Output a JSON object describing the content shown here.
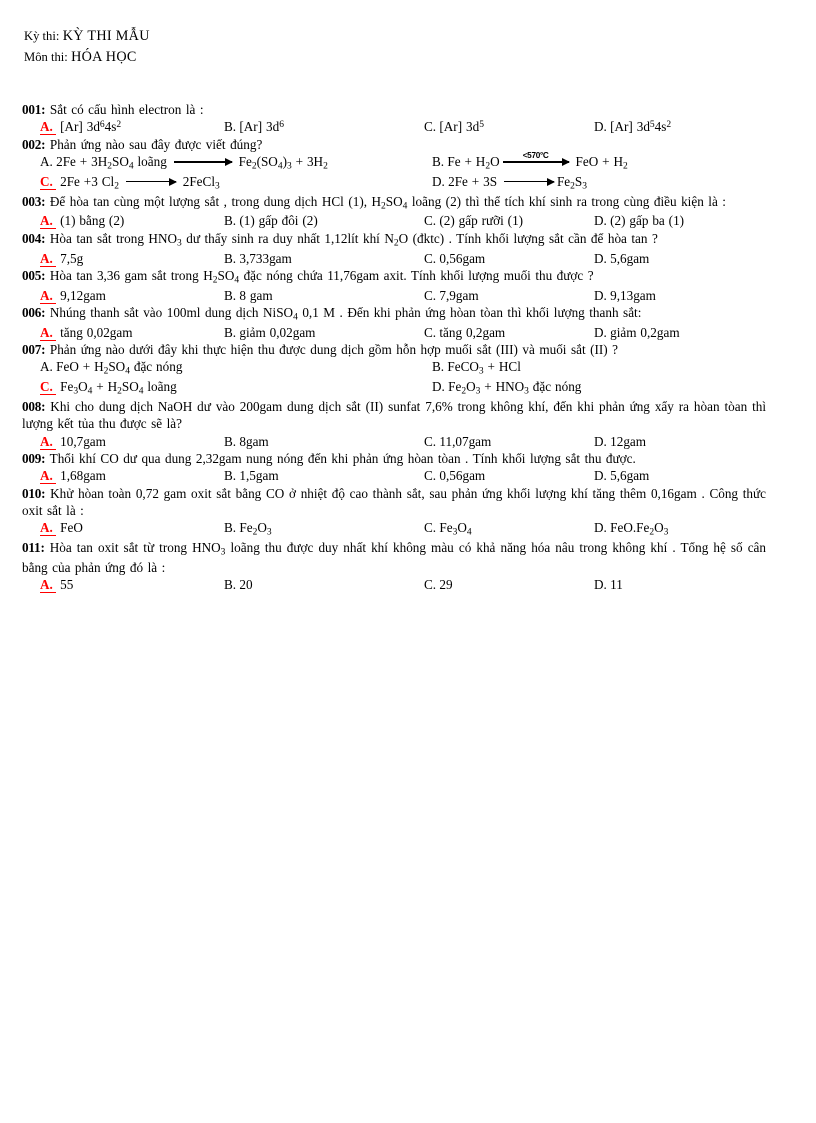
{
  "header": {
    "exam_label": "Kỳ thi:",
    "exam_value": "KỲ THI MẪU",
    "subject_label": "Môn thi:",
    "subject_value": "HÓA HỌC"
  },
  "colors": {
    "correct_answer": "#ff0000",
    "body_text": "#000000",
    "page_background": "#ffffff"
  },
  "questions": [
    {
      "number": "001:",
      "stem": "Sắt có cấu hình  electron  là :",
      "layout": "cols4",
      "options": [
        {
          "label": "A.",
          "correct": true,
          "text_html": "[Ar] 3d<sup>6</sup>4s<sup>2</sup>"
        },
        {
          "label": "B.",
          "correct": false,
          "text_html": "[Ar] 3d<sup>6</sup>"
        },
        {
          "label": "C.",
          "correct": false,
          "text_html": "[Ar] 3d<sup>5</sup>"
        },
        {
          "label": "D.",
          "correct": false,
          "text_html": "[Ar] 3d<sup>5</sup>4s<sup>2</sup>"
        }
      ]
    },
    {
      "number": "002:",
      "stem": "Phản ứng nào sau đây được viết  đúng?",
      "layout": "equations",
      "options": [
        {
          "label": "A.",
          "correct": false,
          "text_html": "2Fe + 3H<sub>2</sub>SO<sub>4</sub> loãng <ARROW-LONG> Fe<sub>2</sub>(SO<sub>4</sub>)<sub>3</sub> + 3H<sub>2</sub>"
        },
        {
          "label": "B.",
          "correct": false,
          "text_html": "Fe + H<sub>2</sub>O<ARROW-COND:&lt;570°C> FeO + H<sub>2</sub>"
        },
        {
          "label": "C.",
          "correct": true,
          "text_html": "2Fe +3 Cl<sub>2</sub> <ARROW-MED> 2FeCl<sub>3</sub>"
        },
        {
          "label": "D.",
          "correct": false,
          "text_html": "2Fe + 3S <ARROW-MED>Fe<sub>2</sub>S<sub>3</sub>"
        }
      ]
    },
    {
      "number": "003:",
      "stem": "Để hòa tan cùng một lượng sắt , trong dung dịch HCl (1), H<sub>2</sub>SO<sub>4</sub> loãng (2) thì thể tích khí sinh ra trong cùng điều kiện là :",
      "layout": "cols4",
      "options": [
        {
          "label": "A.",
          "correct": true,
          "text_html": "(1) bằng (2)"
        },
        {
          "label": "B.",
          "correct": false,
          "text_html": "(1) gấp đôi (2)"
        },
        {
          "label": "C.",
          "correct": false,
          "text_html": "(2) gấp rưỡi (1)"
        },
        {
          "label": "D.",
          "correct": false,
          "text_html": "(2) gấp ba (1)"
        }
      ]
    },
    {
      "number": "004:",
      "stem": "Hòa tan sắt trong HNO<sub>3</sub> dư thấy sinh ra duy nhất 1,12lít khí N<sub>2</sub>O (đktc) . Tính  khối lượng  sắt cần để hòa tan ?",
      "layout": "cols4",
      "options": [
        {
          "label": "A.",
          "correct": true,
          "text_html": "7,5g"
        },
        {
          "label": "B.",
          "correct": false,
          "text_html": "3,733gam"
        },
        {
          "label": "C.",
          "correct": false,
          "text_html": "0,56gam"
        },
        {
          "label": "D.",
          "correct": false,
          "text_html": "5,6gam"
        }
      ]
    },
    {
      "number": "005:",
      "stem": "Hòa tan 3,36 gam  sắt trong H<sub>2</sub>SO<sub>4</sub> đặc nóng chứa 11,76gam axit.  Tính  khối lượng muối thu được ?",
      "layout": "cols4",
      "options": [
        {
          "label": "A.",
          "correct": true,
          "text_html": "9,12gam"
        },
        {
          "label": "B.",
          "correct": false,
          "text_html": "8 gam"
        },
        {
          "label": "C.",
          "correct": false,
          "text_html": "7,9gam"
        },
        {
          "label": "D.",
          "correct": false,
          "text_html": "9,13gam"
        }
      ]
    },
    {
      "number": "006:",
      "stem": "Nhúng  thanh  sắt vào 100ml dung dịch NiSO<sub>4</sub> 0,1 M . Đến khi phản ứng hòan tòan thì khối lượng thanh sắt:",
      "layout": "cols4",
      "options": [
        {
          "label": "A.",
          "correct": true,
          "text_html": "tăng 0,02gam"
        },
        {
          "label": "B.",
          "correct": false,
          "text_html": "giảm 0,02gam"
        },
        {
          "label": "C.",
          "correct": false,
          "text_html": "tăng 0,2gam"
        },
        {
          "label": "D.",
          "correct": false,
          "text_html": "giảm 0,2gam"
        }
      ]
    },
    {
      "number": "007:",
      "stem": "Phản ứng nào dưới đây khi thực hiện thu được dung dịch gồm hỗn hợp muối sắt (III) và muối sắt (II) ?",
      "layout": "cols2",
      "options": [
        {
          "label": "A.",
          "correct": false,
          "text_html": "FeO + H<sub>2</sub>SO<sub>4</sub> đặc nóng"
        },
        {
          "label": "B.",
          "correct": false,
          "text_html": "FeCO<sub>3</sub> + HCl"
        },
        {
          "label": "C.",
          "correct": true,
          "text_html": "Fe<sub>3</sub>O<sub>4</sub> + H<sub>2</sub>SO<sub>4</sub> loãng"
        },
        {
          "label": "D.",
          "correct": false,
          "text_html": "Fe<sub>2</sub>O<sub>3</sub> + HNO<sub>3</sub> đặc nóng"
        }
      ]
    },
    {
      "number": "008:",
      "stem": "Khi cho dung  dịch NaOH dư vào 200gam  dung dịch sắt (II) sunfat  7,6% trong không khí, đến khi phản ứng xẩy ra hòan tòan thì lượng  kết tủa thu được sẽ là?",
      "layout": "cols4",
      "options": [
        {
          "label": "A.",
          "correct": true,
          "text_html": "10,7gam"
        },
        {
          "label": "B.",
          "correct": false,
          "text_html": "8gam"
        },
        {
          "label": "C.",
          "correct": false,
          "text_html": "11,07gam"
        },
        {
          "label": "D.",
          "correct": false,
          "text_html": "12gam"
        }
      ]
    },
    {
      "number": "009:",
      "stem": "Thổi khí CO dư qua dung 2,32gam nung nóng  đến khi  phản ứng hòan tòan . Tính  khối lượng  sắt thu được.",
      "layout": "cols4",
      "options": [
        {
          "label": "A.",
          "correct": true,
          "text_html": "1,68gam"
        },
        {
          "label": "B.",
          "correct": false,
          "text_html": "1,5gam"
        },
        {
          "label": "C.",
          "correct": false,
          "text_html": "0,56gam"
        },
        {
          "label": "D.",
          "correct": false,
          "text_html": "5,6gam"
        }
      ]
    },
    {
      "number": "010:",
      "stem": "Khử hòan toàn 0,72 gam  oxit  sắt  bằng CO ở nhiệt  độ cao thành sắt, sau phản ứng khối lượng khí tăng  thêm 0,16gam . Công thức oxit sắt  là :",
      "layout": "cols4",
      "options": [
        {
          "label": "A.",
          "correct": true,
          "text_html": "FeO"
        },
        {
          "label": "B.",
          "correct": false,
          "text_html": "Fe<sub>2</sub>O<sub>3</sub>"
        },
        {
          "label": "C.",
          "correct": false,
          "text_html": "Fe<sub>3</sub>O<sub>4</sub>"
        },
        {
          "label": "D.",
          "correct": false,
          "text_html": "FeO.Fe<sub>2</sub>O<sub>3</sub>"
        }
      ]
    },
    {
      "number": "011:",
      "stem": "Hòa tan oxit  sắt từ trong HNO<sub>3</sub> loãng  thu được duy nhất  khí  không  màu  có khả năng  hóa nâu  trong không khí . Tổng hệ số cân bằng của phản ứng đó là :",
      "layout": "cols4",
      "options": [
        {
          "label": "A.",
          "correct": true,
          "text_html": "55"
        },
        {
          "label": "B.",
          "correct": false,
          "text_html": "20"
        },
        {
          "label": "C.",
          "correct": false,
          "text_html": "29"
        },
        {
          "label": "D.",
          "correct": false,
          "text_html": "11"
        }
      ]
    }
  ]
}
